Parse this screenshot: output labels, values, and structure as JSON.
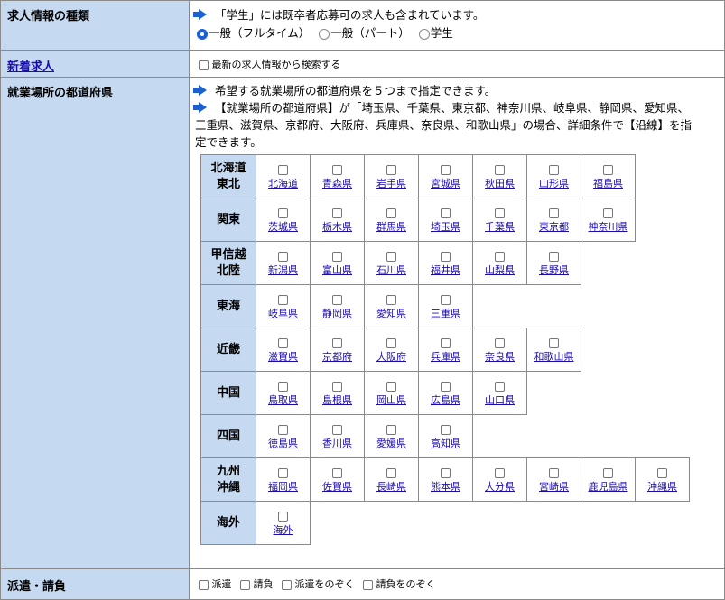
{
  "job_type": {
    "label": "求人情報の種類",
    "note": "「学生」には既卒者応募可の求人も含まれています。",
    "options": [
      "一般（フルタイム）",
      "一般（パート）",
      "学生"
    ],
    "selected_index": 0
  },
  "new_jobs": {
    "label": "新着求人",
    "checkbox_label": "最新の求人情報から検索する"
  },
  "workplace": {
    "label": "就業場所の都道府県",
    "note1": "希望する就業場所の都道府県を５つまで指定できます。",
    "note2a": "【就業場所の都道府県】が「埼玉県、千葉県、東京都、神奈川県、岐阜県、静岡県、愛知県、",
    "note2b": "三重県、滋賀県、京都府、大阪府、兵庫県、奈良県、和歌山県」の場合、詳細条件で【沿線】を指",
    "note2c": "定できます。",
    "regions": [
      {
        "line1": "北海道",
        "line2": "東北",
        "prefs": [
          "北海道",
          "青森県",
          "岩手県",
          "宮城県",
          "秋田県",
          "山形県",
          "福島県"
        ]
      },
      {
        "line1": "関東",
        "line2": "",
        "prefs": [
          "茨城県",
          "栃木県",
          "群馬県",
          "埼玉県",
          "千葉県",
          "東京都",
          "神奈川県"
        ]
      },
      {
        "line1": "甲信越",
        "line2": "北陸",
        "prefs": [
          "新潟県",
          "富山県",
          "石川県",
          "福井県",
          "山梨県",
          "長野県"
        ]
      },
      {
        "line1": "東海",
        "line2": "",
        "prefs": [
          "岐阜県",
          "静岡県",
          "愛知県",
          "三重県"
        ]
      },
      {
        "line1": "近畿",
        "line2": "",
        "prefs": [
          "滋賀県",
          "京都府",
          "大阪府",
          "兵庫県",
          "奈良県",
          "和歌山県"
        ]
      },
      {
        "line1": "中国",
        "line2": "",
        "prefs": [
          "鳥取県",
          "島根県",
          "岡山県",
          "広島県",
          "山口県"
        ]
      },
      {
        "line1": "四国",
        "line2": "",
        "prefs": [
          "徳島県",
          "香川県",
          "愛媛県",
          "高知県"
        ]
      },
      {
        "line1": "九州",
        "line2": "沖縄",
        "prefs": [
          "福岡県",
          "佐賀県",
          "長崎県",
          "熊本県",
          "大分県",
          "宮崎県",
          "鹿児島県",
          "沖縄県"
        ]
      },
      {
        "line1": "海外",
        "line2": "",
        "prefs": [
          "海外"
        ]
      }
    ]
  },
  "dispatch": {
    "label": "派遣・請負",
    "options": [
      "派遣",
      "請負",
      "派遣をのぞく",
      "請負をのぞく"
    ]
  },
  "icons": {
    "arrow": "arrow-right-icon",
    "accent": "#1c5fd0",
    "label_bg": "#c5d9f1"
  }
}
